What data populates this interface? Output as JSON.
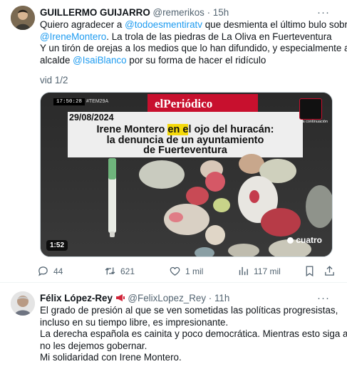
{
  "tweet1": {
    "author_name": "GUILLERMO GUIJARRO",
    "handle": "@remerikos",
    "time": "15h",
    "more": "···",
    "text_line1_pre": "Quiero agradecer a ",
    "mention1": "@todoesmentiratv",
    "text_line1_post": " que desmienta el último bulo sobre",
    "mention2": "@IreneMontero",
    "text_line2_post": ". La trola de las piedras de La Oliva en Fuerteventura",
    "text_line3": "Y un tirón de orejas a los medios que lo han difundido, y especialmente al",
    "text_line4_pre": "alcalde ",
    "mention3": "@IsaiBlanco",
    "text_line4_post": " por su forma de hacer el ridículo",
    "vid_label": "vid 1/2",
    "video": {
      "clock": "17:50:28",
      "tag": "#TEM29A",
      "brand": "elPeriódico",
      "date": "29/08/2024",
      "headline_pre": "Irene Montero ",
      "headline_highlight": "en e",
      "headline_post": "l ojo del huracán:",
      "headline_line2": "la denuncia de un ayuntamiento",
      "headline_line3": "de Fuerteventura",
      "duration": "1:52",
      "watermark": "cuatro",
      "corner_label": "a continuación"
    },
    "actions": {
      "replies": "44",
      "retweets": "621",
      "likes": "1 mil",
      "views": "117 mil"
    }
  },
  "tweet2": {
    "author_name": "Félix López-Rey",
    "handle": "@FelixLopez_Rey",
    "time": "11h",
    "more": "···",
    "line1": "El grado de presión al que se ven sometidas las políticas progresistas,",
    "line2": "incluso en su tiempo libre, es impresionante.",
    "line3": "La derecha española es cainita y poco democrática. Mientras esto siga así,",
    "line4": "no les dejemos gobernar.",
    "line5": "Mi solidaridad con Irene Montero."
  },
  "colors": {
    "link": "#1d9bf0",
    "muted": "#536471",
    "highlight": "#f5d90a"
  }
}
